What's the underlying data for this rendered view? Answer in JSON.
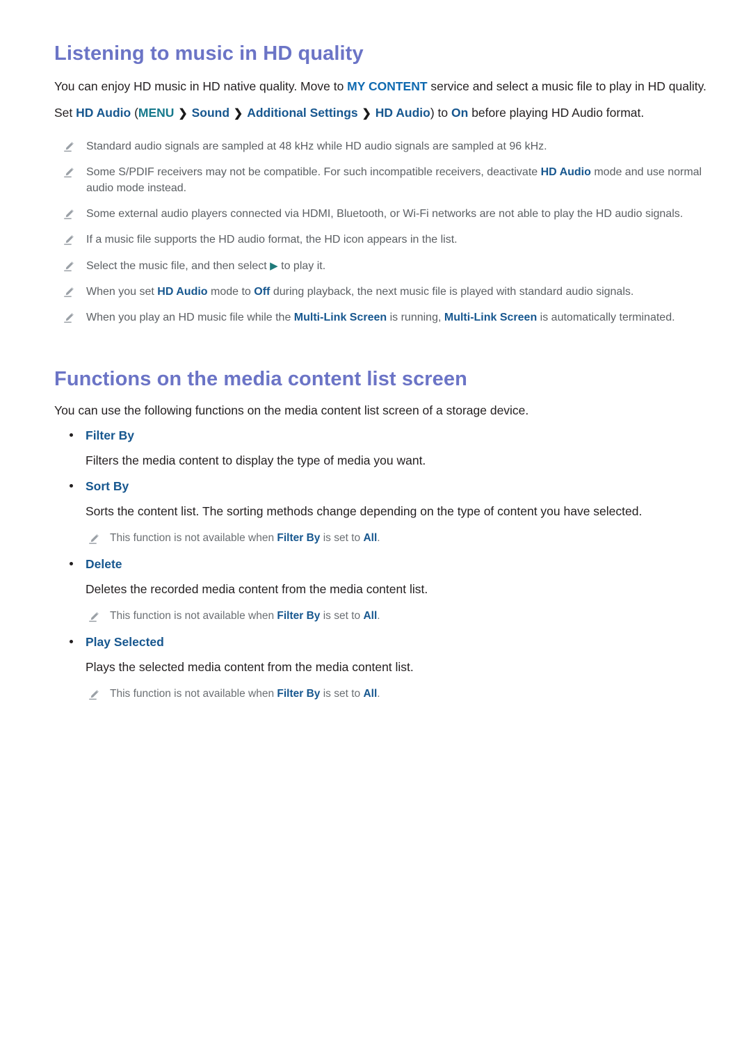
{
  "colors": {
    "heading": "#6b74c6",
    "link_blue": "#17578f",
    "bright_blue": "#0f6ab0",
    "teal": "#16798c",
    "body_text": "#231f20",
    "note_text": "#5b5f63"
  },
  "sections": [
    {
      "heading": "Listening to music in HD quality",
      "intro": {
        "part1": "You can enjoy HD music in HD native quality. Move to ",
        "highlight1": "MY CONTENT",
        "part2": " service and select a music file to play in HD quality."
      },
      "set_line": {
        "set": "Set ",
        "hd_audio": "HD Audio",
        "open_paren": " (",
        "menu": "MENU",
        "chevron": "❯",
        "sound": "Sound",
        "additional_settings": "Additional Settings",
        "hd_audio_2": "HD Audio",
        "close_paren": ") to ",
        "on": "On",
        "tail": " before playing HD Audio format."
      },
      "notes": [
        {
          "icon": "pencil-icon",
          "segments": [
            {
              "text": "Standard audio signals are sampled at 48 kHz while HD audio signals are sampled at 96 kHz.",
              "style": "plain"
            }
          ]
        },
        {
          "icon": "pencil-icon",
          "segments": [
            {
              "text": "Some S/PDIF receivers may not be compatible. For such incompatible receivers, deactivate ",
              "style": "plain"
            },
            {
              "text": "HD Audio",
              "style": "hl"
            },
            {
              "text": " mode and use normal audio mode instead.",
              "style": "plain"
            }
          ]
        },
        {
          "icon": "pencil-icon",
          "segments": [
            {
              "text": "Some external audio players connected via HDMI, Bluetooth, or Wi-Fi networks are not able to play the HD audio signals.",
              "style": "plain"
            }
          ]
        },
        {
          "icon": "pencil-icon",
          "segments": [
            {
              "text": "If a music file supports the HD audio format, the HD icon appears in the list.",
              "style": "plain"
            }
          ]
        },
        {
          "icon": "pencil-icon",
          "segments": [
            {
              "text": "Select the music file, and then select ",
              "style": "plain"
            },
            {
              "text": "▶",
              "style": "play"
            },
            {
              "text": " to play it.",
              "style": "plain"
            }
          ]
        },
        {
          "icon": "pencil-icon",
          "segments": [
            {
              "text": "When you set ",
              "style": "plain"
            },
            {
              "text": "HD Audio",
              "style": "hl"
            },
            {
              "text": " mode to ",
              "style": "plain"
            },
            {
              "text": "Off",
              "style": "hl"
            },
            {
              "text": " during playback, the next music file is played with standard audio signals.",
              "style": "plain"
            }
          ]
        },
        {
          "icon": "pencil-icon",
          "segments": [
            {
              "text": "When you play an HD music file while the ",
              "style": "plain"
            },
            {
              "text": "Multi-Link Screen",
              "style": "hl"
            },
            {
              "text": " is running, ",
              "style": "plain"
            },
            {
              "text": "Multi-Link Screen",
              "style": "hl"
            },
            {
              "text": " is automatically terminated.",
              "style": "plain"
            }
          ]
        }
      ]
    },
    {
      "heading": "Functions on the media content list screen",
      "intro": "You can use the following functions on the media content list screen of a storage device.",
      "items": [
        {
          "label": "Filter By",
          "description": "Filters the media content to display the type of media you want.",
          "note": null
        },
        {
          "label": "Sort By",
          "description": "Sorts the content list. The sorting methods change depending on the type of content you have selected.",
          "note": {
            "icon": "pencil-icon",
            "prefix": "This function is not available when ",
            "link": "Filter By",
            "middle": " is set to ",
            "value": "All",
            "suffix": "."
          }
        },
        {
          "label": "Delete",
          "description": "Deletes the recorded media content from the media content list.",
          "note": {
            "icon": "pencil-icon",
            "prefix": "This function is not available when ",
            "link": "Filter By",
            "middle": " is set to ",
            "value": "All",
            "suffix": "."
          }
        },
        {
          "label": "Play Selected",
          "description": "Plays the selected media content from the media content list.",
          "note": {
            "icon": "pencil-icon",
            "prefix": "This function is not available when ",
            "link": "Filter By",
            "middle": " is set to ",
            "value": "All",
            "suffix": "."
          }
        }
      ]
    }
  ]
}
